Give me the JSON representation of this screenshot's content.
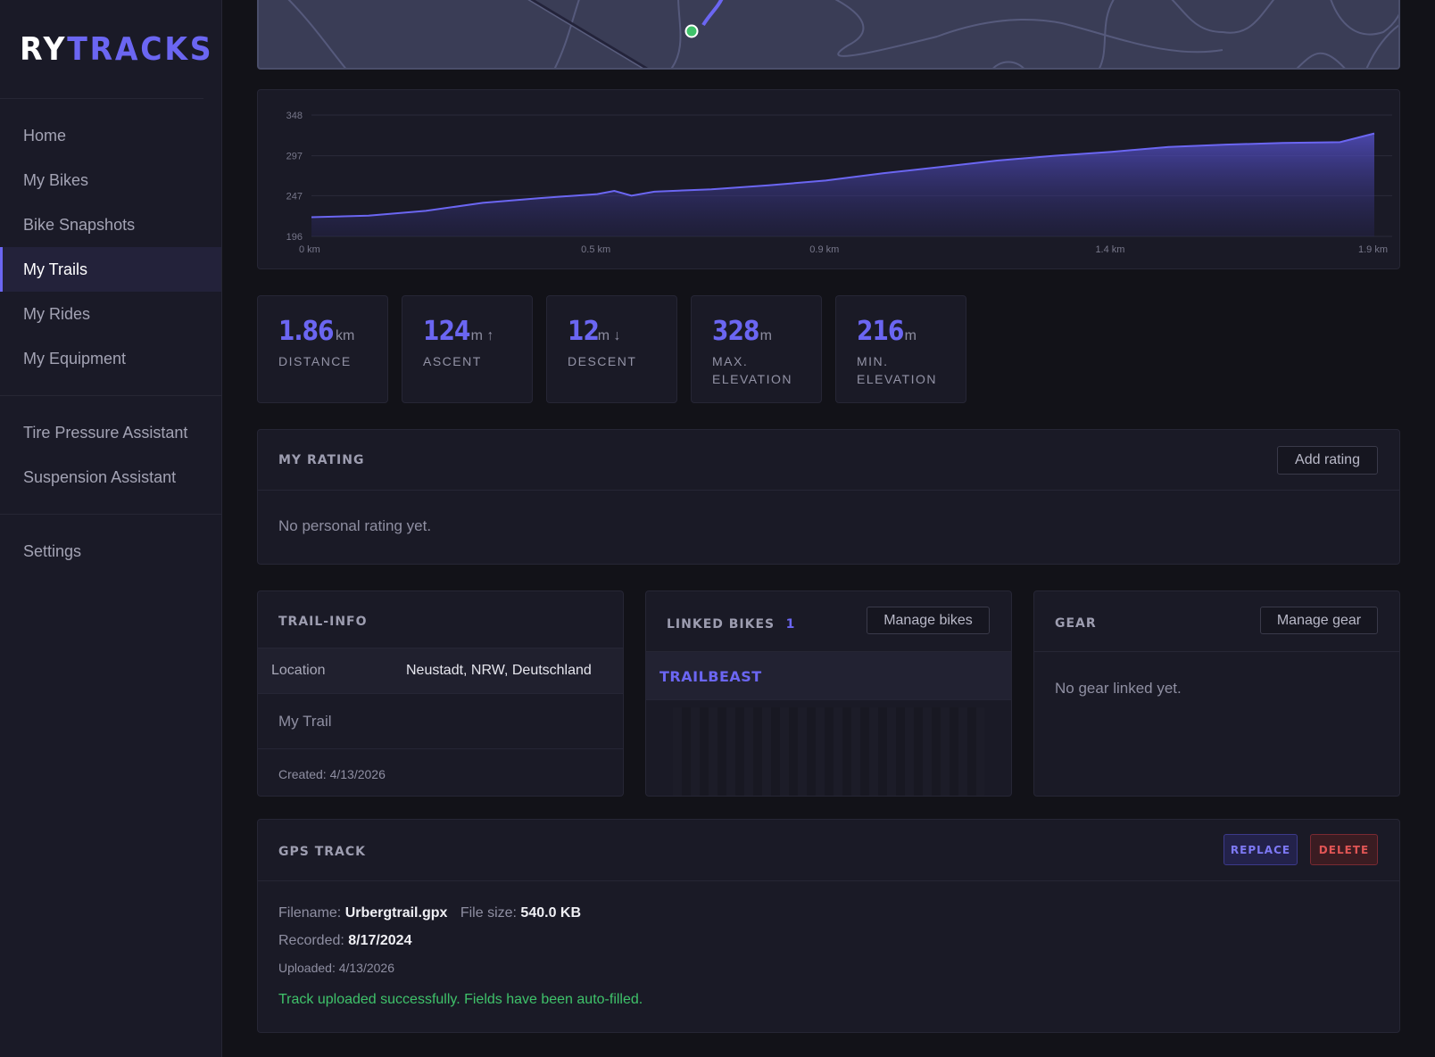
{
  "brand": {
    "part1": "RY",
    "part2": "TRACKS"
  },
  "nav": {
    "group1": [
      "Home",
      "My Bikes",
      "Bike Snapshots",
      "My Trails",
      "My Rides",
      "My Equipment"
    ],
    "group2": [
      "Tire Pressure Assistant",
      "Suspension Assistant"
    ],
    "group3": [
      "Settings"
    ],
    "active": "My Trails"
  },
  "elevation": {
    "y_ticks": [
      "348",
      "297",
      "247",
      "196"
    ],
    "x_ticks": [
      "0 km",
      "0.5 km",
      "0.9 km",
      "1.4 km",
      "1.9 km"
    ]
  },
  "chart_data": {
    "type": "area",
    "x_unit": "km",
    "y_unit": "m",
    "ylim": [
      196,
      348
    ],
    "xlim": [
      0,
      1.86
    ],
    "x": [
      0,
      0.1,
      0.2,
      0.3,
      0.4,
      0.5,
      0.53,
      0.56,
      0.6,
      0.7,
      0.8,
      0.9,
      1.0,
      1.1,
      1.2,
      1.3,
      1.4,
      1.5,
      1.6,
      1.7,
      1.8,
      1.86
    ],
    "y": [
      220,
      222,
      228,
      238,
      244,
      249,
      253,
      247,
      252,
      255,
      260,
      266,
      275,
      283,
      291,
      297,
      302,
      308,
      311,
      313,
      314,
      325
    ],
    "grid": true
  },
  "stats": [
    {
      "value": "1.86",
      "unit": "km",
      "label1": "DISTANCE",
      "label2": ""
    },
    {
      "value": "124",
      "unit": "m ↑",
      "label1": "ASCENT",
      "label2": ""
    },
    {
      "value": "12",
      "unit": "m ↓",
      "label1": "DESCENT",
      "label2": ""
    },
    {
      "value": "328",
      "unit": "m",
      "label1": "MAX.",
      "label2": "ELEVATION"
    },
    {
      "value": "216",
      "unit": "m",
      "label1": "MIN.",
      "label2": "ELEVATION"
    }
  ],
  "rating": {
    "title": "MY RATING",
    "add_button": "Add rating",
    "empty_text": "No personal rating yet."
  },
  "trail_info": {
    "title": "TRAIL-INFO",
    "location_label": "Location",
    "location_value": "Neustadt, NRW, Deutschland",
    "name": "My Trail",
    "created": "Created: 4/13/2026"
  },
  "linked_bikes": {
    "title": "LINKED BIKES",
    "count": "1",
    "manage_button": "Manage bikes",
    "bike_name": "TRAILBEAST"
  },
  "gear": {
    "title": "GEAR",
    "manage_button": "Manage gear",
    "empty_text": "No gear linked yet."
  },
  "gps_track": {
    "title": "GPS TRACK",
    "replace_button": "REPLACE",
    "delete_button": "DELETE",
    "filename_label": "Filename:",
    "filename_value": "Urbergtrail.gpx",
    "filesize_label": "File size:",
    "filesize_value": "540.0 KB",
    "recorded_label": "Recorded:",
    "recorded_value": "8/17/2024",
    "uploaded": "Uploaded: 4/13/2026",
    "success_message": "Track uploaded successfully. Fields have been auto-filled."
  },
  "colors": {
    "accent": "#6b66f2",
    "success": "#3fc26a",
    "danger": "#e05555"
  }
}
